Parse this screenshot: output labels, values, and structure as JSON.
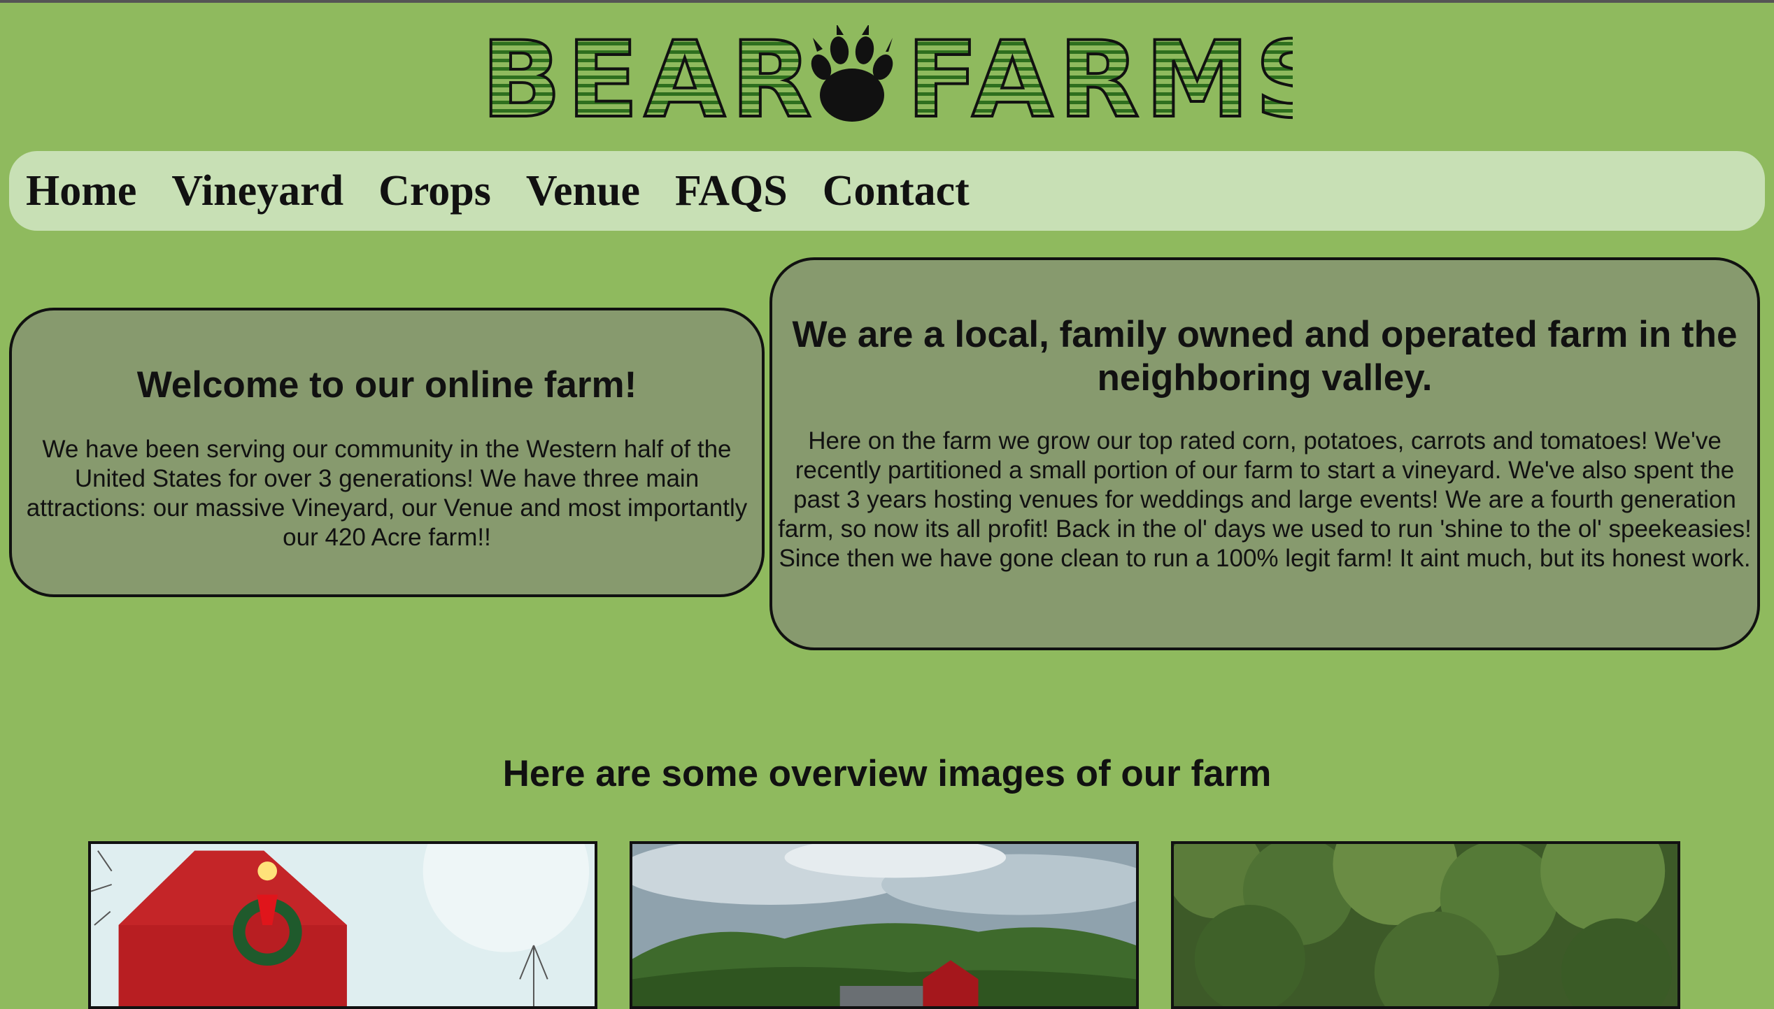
{
  "logo": {
    "word1": "BEAR",
    "word2": "FARMS",
    "icon": "bear-paw-icon"
  },
  "nav": {
    "items": [
      {
        "label": "Home"
      },
      {
        "label": "Vineyard"
      },
      {
        "label": "Crops"
      },
      {
        "label": "Venue"
      },
      {
        "label": "FAQS"
      },
      {
        "label": "Contact"
      }
    ]
  },
  "welcome": {
    "title": "Welcome to our online farm!",
    "body": "We have been serving our community in the Western half of the United States for over 3 generations! We have three main attractions: our massive Vineyard, our Venue and most importantly our 420 Acre farm!!"
  },
  "about": {
    "title": "We are a local, family owned and operated farm in the neighboring valley.",
    "body": "Here on the farm we grow our top rated corn, potatoes, carrots and tomatoes! We've recently partitioned a small portion of our farm to start a vineyard. We've also spent the past 3 years hosting venues for weddings and large events! We are a fourth generation farm, so now its all profit! Back in the ol' days we used to run 'shine to the ol' speekeasies! Since then we have gone clean to run a 100% legit farm! It aint much, but its honest work."
  },
  "overview": {
    "title": "Here are some overview images of our farm"
  },
  "colors": {
    "background": "#8fba5e",
    "nav_bg": "#c8e0b5",
    "box_bg": "#879a6e",
    "logo_stripe": "#3f8a2a"
  }
}
